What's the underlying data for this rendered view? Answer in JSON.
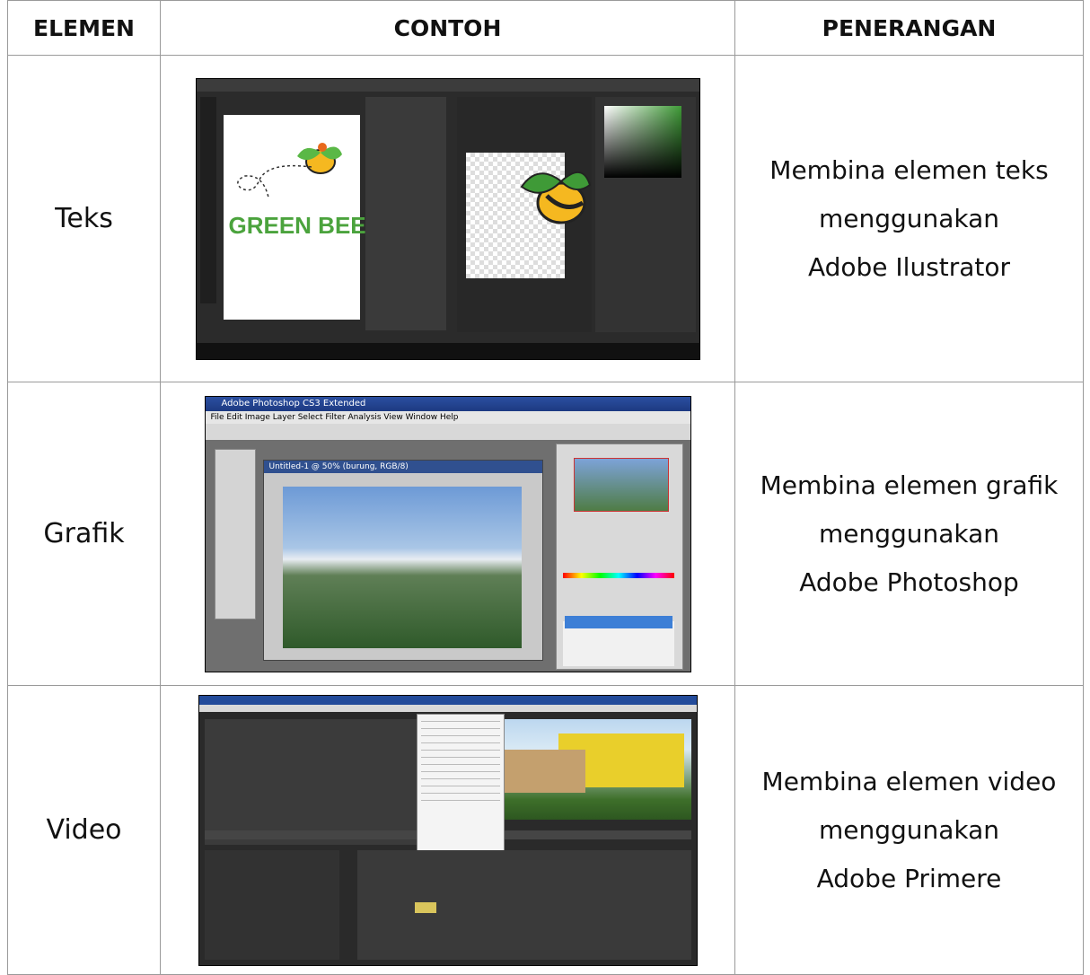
{
  "table": {
    "headers": [
      "ELEMEN",
      "CONTOH",
      "PENERANGAN"
    ],
    "rows": [
      {
        "element": "Teks",
        "example_text": "GREEN BEE",
        "description": [
          "Membina elemen teks",
          "menggunakan",
          "Adobe Ilustrator"
        ]
      },
      {
        "element": "Grafik",
        "example_title": "Adobe Photoshop CS3 Extended",
        "example_menu": "File  Edit  Image  Layer  Select  Filter  Analysis  View  Window  Help",
        "example_doc": "Untitled-1 @ 50% (burung, RGB/8)",
        "description": [
          "Membina elemen grafik",
          "menggunakan",
          "Adobe Photoshop"
        ]
      },
      {
        "element": "Video",
        "description": [
          "Membina elemen video",
          "menggunakan",
          "Adobe Primere"
        ]
      }
    ]
  },
  "colors": {
    "border": "#9a9a9a",
    "text": "#111111",
    "bee_green": "#4ba33d"
  }
}
